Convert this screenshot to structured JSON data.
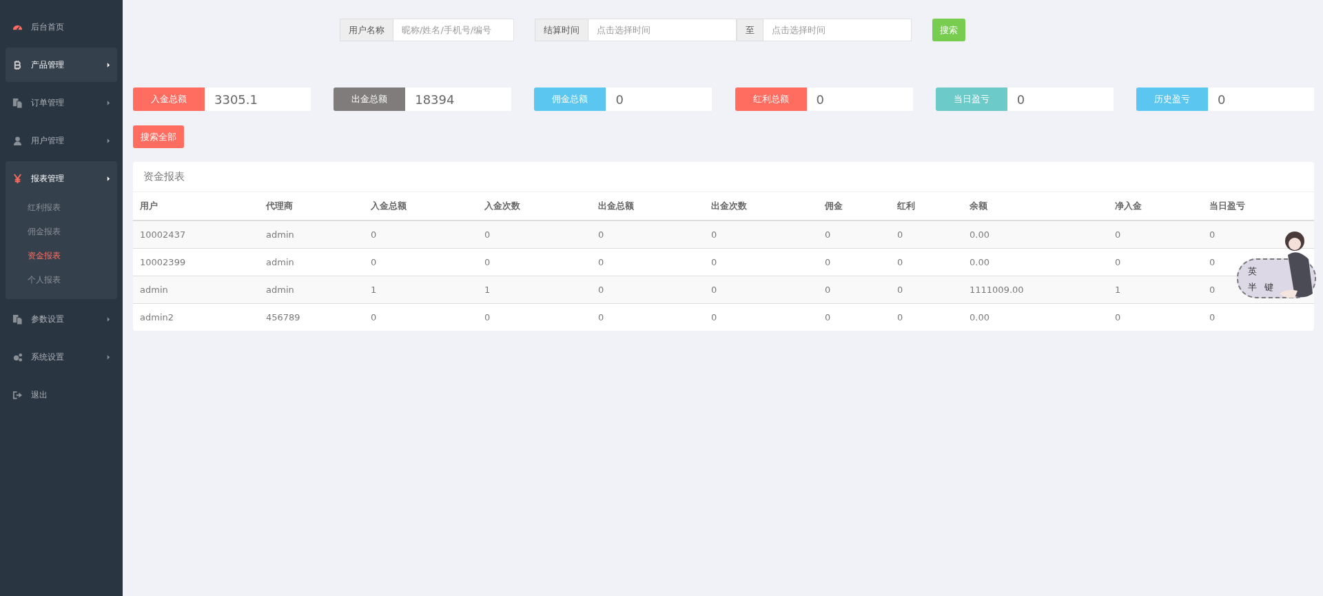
{
  "sidebar": {
    "items": [
      {
        "kind": "link",
        "label": "后台首页",
        "hovered": false
      },
      {
        "kind": "menu",
        "label": "产品管理",
        "hovered": true,
        "expanded": false
      },
      {
        "kind": "menu",
        "label": "订单管理",
        "hovered": false,
        "expanded": false
      },
      {
        "kind": "menu",
        "label": "用户管理",
        "hovered": false,
        "expanded": false
      },
      {
        "kind": "menu",
        "label": "报表管理",
        "hovered": false,
        "expanded": true,
        "children": [
          {
            "label": "红利报表",
            "selected": false
          },
          {
            "label": "佣金报表",
            "selected": false
          },
          {
            "label": "资金报表",
            "selected": true
          },
          {
            "label": "个人报表",
            "selected": false
          }
        ]
      },
      {
        "kind": "menu",
        "label": "参数设置",
        "hovered": false,
        "expanded": false
      },
      {
        "kind": "menu",
        "label": "系统设置",
        "hovered": false,
        "expanded": false
      },
      {
        "kind": "link",
        "label": "退出",
        "hovered": false
      }
    ]
  },
  "search": {
    "user_label": "用户名称",
    "user_placeholder": "昵称/姓名/手机号/编号",
    "time_label": "结算时间",
    "start_placeholder": "点击选择时间",
    "separator": "至",
    "end_placeholder": "点击选择时间",
    "button": "搜索"
  },
  "stats": [
    {
      "label": "入金总额",
      "value": "3305.1",
      "color": "#ff6c60"
    },
    {
      "label": "出金总额",
      "value": "18394",
      "color": "#817c7c"
    },
    {
      "label": "佣金总额",
      "value": "0",
      "color": "#5bc6f0"
    },
    {
      "label": "红利总额",
      "value": "0",
      "color": "#ff6c60"
    },
    {
      "label": "当日盈亏",
      "value": "0",
      "color": "#6ccac9"
    },
    {
      "label": "历史盈亏",
      "value": "0",
      "color": "#5bc6f0"
    }
  ],
  "search_all_button": "搜索全部",
  "table": {
    "title": "资金报表",
    "columns": [
      "用户",
      "代理商",
      "入金总额",
      "入金次数",
      "出金总额",
      "出金次数",
      "佣金",
      "红利",
      "余额",
      "净入金",
      "当日盈亏"
    ],
    "rows": [
      [
        "10002437",
        "admin",
        "0",
        "0",
        "0",
        "0",
        "0",
        "0",
        "0.00",
        "0",
        "0"
      ],
      [
        "10002399",
        "admin",
        "0",
        "0",
        "0",
        "0",
        "0",
        "0",
        "0.00",
        "0",
        "0"
      ],
      [
        "admin",
        "admin",
        "1",
        "1",
        "0",
        "0",
        "0",
        "0",
        "1111009.00",
        "1",
        "0"
      ],
      [
        "admin2",
        "456789",
        "0",
        "0",
        "0",
        "0",
        "0",
        "0",
        "0.00",
        "0",
        "0"
      ]
    ]
  },
  "ime_widget": {
    "mode": "英",
    "width": "半",
    "keyboard": "键"
  }
}
